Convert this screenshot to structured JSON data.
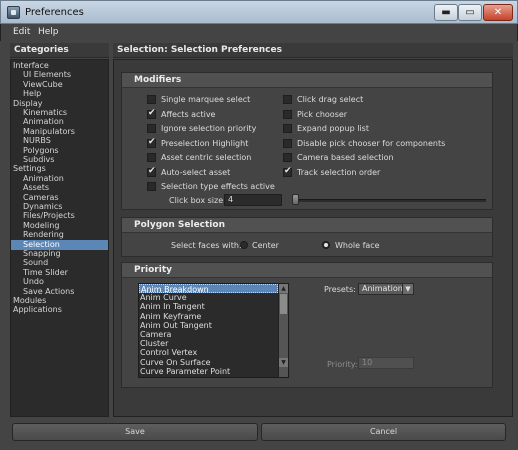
{
  "window": {
    "title": "Preferences",
    "min_glyph": "▬",
    "max_glyph": "▭",
    "close_glyph": "✕"
  },
  "menubar": [
    "Edit",
    "Help"
  ],
  "categories": {
    "header": "Categories",
    "items": [
      {
        "label": "Interface",
        "level": 0
      },
      {
        "label": "UI Elements",
        "level": 1
      },
      {
        "label": "ViewCube",
        "level": 1
      },
      {
        "label": "Help",
        "level": 1
      },
      {
        "label": "Display",
        "level": 0
      },
      {
        "label": "Kinematics",
        "level": 1
      },
      {
        "label": "Animation",
        "level": 1
      },
      {
        "label": "Manipulators",
        "level": 1
      },
      {
        "label": "NURBS",
        "level": 1
      },
      {
        "label": "Polygons",
        "level": 1
      },
      {
        "label": "Subdivs",
        "level": 1
      },
      {
        "label": "Settings",
        "level": 0
      },
      {
        "label": "Animation",
        "level": 1
      },
      {
        "label": "Assets",
        "level": 1
      },
      {
        "label": "Cameras",
        "level": 1
      },
      {
        "label": "Dynamics",
        "level": 1
      },
      {
        "label": "Files/Projects",
        "level": 1
      },
      {
        "label": "Modeling",
        "level": 1
      },
      {
        "label": "Rendering",
        "level": 1
      },
      {
        "label": "Selection",
        "level": 1,
        "selected": true
      },
      {
        "label": "Snapping",
        "level": 1
      },
      {
        "label": "Sound",
        "level": 1
      },
      {
        "label": "Time Slider",
        "level": 1
      },
      {
        "label": "Undo",
        "level": 1
      },
      {
        "label": "Save Actions",
        "level": 1
      },
      {
        "label": "Modules",
        "level": 0
      },
      {
        "label": "Applications",
        "level": 0
      }
    ]
  },
  "main": {
    "header": "Selection: Selection Preferences",
    "modifiers": {
      "title": "Modifiers",
      "left": [
        {
          "label": "Single marquee select",
          "checked": false
        },
        {
          "label": "Affects active",
          "checked": true
        },
        {
          "label": "Ignore selection priority",
          "checked": false
        },
        {
          "label": "Preselection Highlight",
          "checked": true
        },
        {
          "label": "Asset centric selection",
          "checked": false
        },
        {
          "label": "Auto-select asset",
          "checked": true
        },
        {
          "label": "Selection type effects active",
          "checked": false
        }
      ],
      "right": [
        {
          "label": "Click drag select",
          "checked": false
        },
        {
          "label": "Pick chooser",
          "checked": false
        },
        {
          "label": "Expand popup list",
          "checked": false
        },
        {
          "label": "Disable pick chooser for components",
          "checked": false
        },
        {
          "label": "Camera based selection",
          "checked": false
        },
        {
          "label": "Track selection order",
          "checked": true
        }
      ],
      "click_box_label": "Click box size:",
      "click_box_value": "4"
    },
    "polygon_selection": {
      "title": "Polygon Selection",
      "label": "Select faces with:",
      "options": [
        "Center",
        "Whole face"
      ],
      "selected": "Whole face"
    },
    "priority": {
      "title": "Priority",
      "list": [
        "Anim Breakdown",
        "Anim Curve",
        "Anim In Tangent",
        "Anim Keyframe",
        "Anim Out Tangent",
        "Camera",
        "Cluster",
        "Control Vertex",
        "Curve On Surface",
        "Curve Parameter Point"
      ],
      "selected_index": 0,
      "presets_label": "Presets:",
      "presets_value": "Animation",
      "priority_label": "Priority:",
      "priority_value": "10",
      "scroll_up": "▲",
      "scroll_down": "▼",
      "dropdown_arrow": "▼"
    }
  },
  "buttons": {
    "save": "Save",
    "cancel": "Cancel"
  }
}
